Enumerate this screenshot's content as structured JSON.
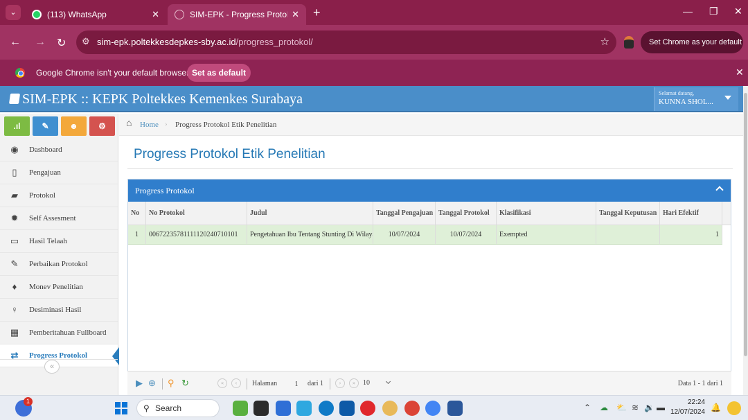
{
  "browser": {
    "tabs": [
      {
        "title": "(113) WhatsApp",
        "active": false
      },
      {
        "title": "SIM-EPK - Progress Protokol Eti",
        "active": true
      }
    ],
    "url": {
      "domain": "sim-epk.poltekkesdepkes-sby.ac.id",
      "path": "/progress_protokol/"
    },
    "set_default_pill": "Set Chrome as your default",
    "infobar": {
      "message": "Google Chrome isn't your default browser",
      "button": "Set as default"
    }
  },
  "app": {
    "title": "SIM-EPK :: KEPK Poltekkes Kemenkes Surabaya",
    "user": {
      "greeting": "Selamat datang,",
      "name": "KUNNA SHOL..."
    }
  },
  "sidebar": {
    "shortcuts": [
      {
        "icon": "bar-chart-icon",
        "color": "#7dbb43"
      },
      {
        "icon": "pencil-icon",
        "color": "#3f8fd0"
      },
      {
        "icon": "users-icon",
        "color": "#f3a83b"
      },
      {
        "icon": "cogs-icon",
        "color": "#d4534f"
      }
    ],
    "items": [
      {
        "label": "Dashboard",
        "icon": "dashboard-icon"
      },
      {
        "label": "Pengajuan",
        "icon": "file-icon"
      },
      {
        "label": "Protokol",
        "icon": "book-icon"
      },
      {
        "label": "Self Assesment",
        "icon": "certificate-icon"
      },
      {
        "label": "Hasil Telaah",
        "icon": "desktop-icon"
      },
      {
        "label": "Perbaikan Protokol",
        "icon": "edit-icon"
      },
      {
        "label": "Monev Penelitian",
        "icon": "pin-icon"
      },
      {
        "label": "Desiminasi Hasil",
        "icon": "lightbulb-icon"
      },
      {
        "label": "Pemberitahuan Fullboard",
        "icon": "grid-icon"
      },
      {
        "label": "Progress Protokol",
        "icon": "exchange-icon",
        "active": true
      }
    ]
  },
  "breadcrumb": {
    "home": "Home",
    "current": "Progress Protokol Etik Penelitian"
  },
  "page": {
    "title": "Progress Protokol Etik Penelitian"
  },
  "grid": {
    "caption": "Progress Protokol",
    "columns": [
      "No",
      "No Protokol",
      "Judul",
      "Tanggal Pengajuan",
      "Tanggal Protokol",
      "Klasifikasi",
      "Tanggal Keputusan",
      "Hari Efektif"
    ],
    "rows": [
      [
        "1",
        "00672235781111120240710101",
        "Pengetahuan Ibu Tentang Stunting Di Wilayah",
        "10/07/2024",
        "10/07/2024",
        "Exempted",
        "",
        "1"
      ]
    ]
  },
  "pager": {
    "page_label": "Halaman",
    "page_value": "1",
    "of_label": "dari 1",
    "rows_per_page": "10",
    "info": "Data 1 - 1 dari 1"
  },
  "taskbar": {
    "weather_badge": "1",
    "search_label": "Search",
    "time": "22:24",
    "date": "12/07/2024"
  },
  "colors": {
    "brand_header": "#4a8ec9",
    "grid_caption": "#307ecc",
    "row_highlight": "#dff0d8",
    "chrome_theme": "#a03362"
  }
}
